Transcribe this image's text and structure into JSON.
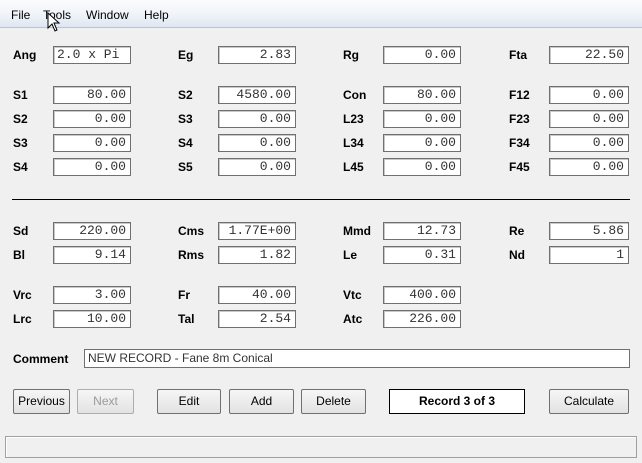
{
  "menu": [
    "File",
    "Tools",
    "Window",
    "Help"
  ],
  "params": {
    "ang": {
      "label": "Ang",
      "value": "2.0 x Pi"
    },
    "eg": {
      "label": "Eg",
      "value": "2.83"
    },
    "rg": {
      "label": "Rg",
      "value": "0.00"
    },
    "fta": {
      "label": "Fta",
      "value": "22.50"
    },
    "s1": {
      "label": "S1",
      "value": "80.00"
    },
    "s2b": {
      "label": "S2",
      "value": "4580.00"
    },
    "con": {
      "label": "Con",
      "value": "80.00"
    },
    "f12": {
      "label": "F12",
      "value": "0.00"
    },
    "s2": {
      "label": "S2",
      "value": "0.00"
    },
    "s3b": {
      "label": "S3",
      "value": "0.00"
    },
    "l23": {
      "label": "L23",
      "value": "0.00"
    },
    "f23": {
      "label": "F23",
      "value": "0.00"
    },
    "s3": {
      "label": "S3",
      "value": "0.00"
    },
    "s4b": {
      "label": "S4",
      "value": "0.00"
    },
    "l34": {
      "label": "L34",
      "value": "0.00"
    },
    "f34": {
      "label": "F34",
      "value": "0.00"
    },
    "s4": {
      "label": "S4",
      "value": "0.00"
    },
    "s5": {
      "label": "S5",
      "value": "0.00"
    },
    "l45": {
      "label": "L45",
      "value": "0.00"
    },
    "f45": {
      "label": "F45",
      "value": "0.00"
    },
    "sd": {
      "label": "Sd",
      "value": "220.00"
    },
    "cms": {
      "label": "Cms",
      "value": "1.77E+00"
    },
    "mmd": {
      "label": "Mmd",
      "value": "12.73"
    },
    "re": {
      "label": "Re",
      "value": "5.86"
    },
    "bl": {
      "label": "Bl",
      "value": "9.14"
    },
    "rms": {
      "label": "Rms",
      "value": "1.82"
    },
    "le": {
      "label": "Le",
      "value": "0.31"
    },
    "nd": {
      "label": "Nd",
      "value": "1"
    },
    "vrc": {
      "label": "Vrc",
      "value": "3.00"
    },
    "fr": {
      "label": "Fr",
      "value": "40.00"
    },
    "vtc": {
      "label": "Vtc",
      "value": "400.00"
    },
    "lrc": {
      "label": "Lrc",
      "value": "10.00"
    },
    "tal": {
      "label": "Tal",
      "value": "2.54"
    },
    "atc": {
      "label": "Atc",
      "value": "226.00"
    }
  },
  "comment": {
    "label": "Comment",
    "value": "NEW RECORD - Fane 8m Conical"
  },
  "buttons": {
    "previous": "Previous",
    "next": "Next",
    "edit": "Edit",
    "add": "Add",
    "delete": "Delete",
    "calculate": "Calculate"
  },
  "record": "Record 3 of 3",
  "status": ""
}
